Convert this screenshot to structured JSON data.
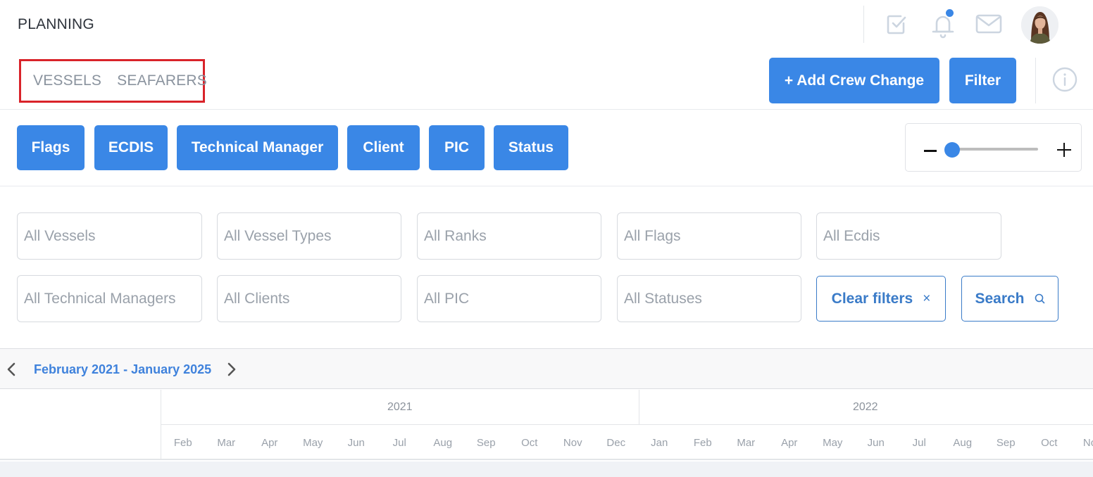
{
  "header": {
    "title": "PLANNING",
    "icons": [
      "tasks-check-icon",
      "bell-icon",
      "mail-icon"
    ],
    "notification_dot": true,
    "avatar_alt": "user-avatar"
  },
  "tabs": [
    {
      "label": "VESSELS"
    },
    {
      "label": "SEAFARERS"
    }
  ],
  "actions": {
    "add_crew_change": "+ Add Crew Change",
    "filter": "Filter",
    "info_icon": "info-icon"
  },
  "chips": [
    {
      "label": "Flags"
    },
    {
      "label": "ECDIS"
    },
    {
      "label": "Technical Manager"
    },
    {
      "label": "Client"
    },
    {
      "label": "PIC"
    },
    {
      "label": "Status"
    }
  ],
  "zoom_slider": {
    "minus": "−",
    "plus": "+",
    "value_fraction": 0.0
  },
  "filters": {
    "row1": [
      {
        "placeholder": "All Vessels"
      },
      {
        "placeholder": "All Vessel Types"
      },
      {
        "placeholder": "All Ranks"
      },
      {
        "placeholder": "All Flags"
      },
      {
        "placeholder": "All Ecdis"
      }
    ],
    "row2": [
      {
        "placeholder": "All Technical Managers"
      },
      {
        "placeholder": "All Clients"
      },
      {
        "placeholder": "All PIC"
      },
      {
        "placeholder": "All Statuses"
      }
    ],
    "clear_label": "Clear filters",
    "clear_icon": "×",
    "search_label": "Search"
  },
  "timeline": {
    "range_label": "February 2021 - January 2025",
    "years": [
      {
        "label": "2021",
        "months": [
          "Feb",
          "Mar",
          "Apr",
          "May",
          "Jun",
          "Jul",
          "Aug",
          "Sep",
          "Oct",
          "Nov",
          "Dec"
        ]
      },
      {
        "label": "2022",
        "months": [
          "Jan",
          "Feb",
          "Mar",
          "Apr",
          "May",
          "Jun",
          "Jul",
          "Aug",
          "Sep",
          "Oct",
          "Nov"
        ]
      }
    ]
  },
  "colors": {
    "primary": "#3a87e6",
    "highlight_box": "#d9232a",
    "outline_button": "#3a7bc8",
    "range_label": "#3f82dc"
  }
}
